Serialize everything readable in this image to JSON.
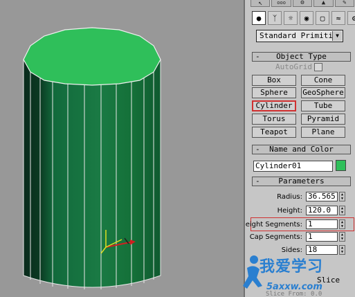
{
  "command_panel": {
    "tabs": [
      "",
      "",
      "",
      "",
      ""
    ],
    "icons": [
      "geometry-icon",
      "shapes-icon",
      "lights-icon",
      "cameras-icon",
      "helpers-icon",
      "spacewarps-icon",
      "systems-icon"
    ],
    "category_dropdown": "Standard Primitiv",
    "object_type": {
      "header": "Object Type",
      "collapse": "-",
      "autogrid_label": "AutoGrid",
      "buttons": [
        "Box",
        "Cone",
        "Sphere",
        "GeoSphere",
        "Cylinder",
        "Tube",
        "Torus",
        "Pyramid",
        "Teapot",
        "Plane"
      ],
      "selected": "Cylinder"
    },
    "name_and_color": {
      "header": "Name and Color",
      "collapse": "-",
      "name": "Cylinder01",
      "color": "#2fbf5a"
    },
    "parameters": {
      "header": "Parameters",
      "collapse": "-",
      "fields": [
        {
          "label": "Radius:",
          "value": "36.565"
        },
        {
          "label": "Height:",
          "value": "120.0"
        },
        {
          "label": "Height Segments:",
          "value": "1"
        },
        {
          "label": "Cap Segments:",
          "value": "1"
        },
        {
          "label": "Sides:",
          "value": "18"
        }
      ],
      "smooth_label": "",
      "slice_label": "Slice",
      "slice_from_label": "Slice From:",
      "slice_from_value": "0.0"
    }
  },
  "viewport": {
    "object_color": "#2fbf5a",
    "side_color": "#106a3c",
    "background": "#989898"
  },
  "watermark": {
    "text": "我爱学习",
    "url": "5axxw.com"
  }
}
